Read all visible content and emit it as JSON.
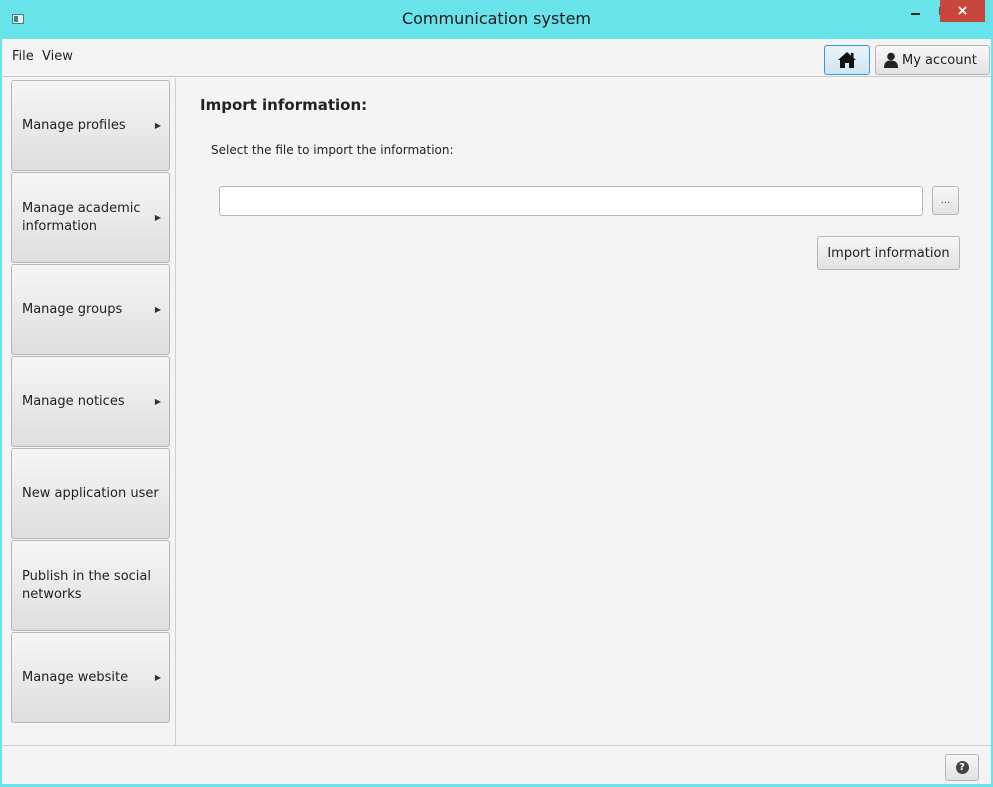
{
  "window": {
    "title": "Communication system",
    "close_glyph": "×",
    "accent_color": "#68e3ea",
    "close_color": "#c7463d"
  },
  "menubar": {
    "items": [
      {
        "label": "File"
      },
      {
        "label": "View"
      }
    ]
  },
  "header": {
    "home_icon": "home-icon",
    "account_label": "My account",
    "account_icon": "user-icon"
  },
  "sidebar": {
    "items": [
      {
        "label": "Manage profiles",
        "arrow": "▶"
      },
      {
        "label": "Manage academic information",
        "arrow": "▶"
      },
      {
        "label": "Manage groups",
        "arrow": "▶"
      },
      {
        "label": "Manage notices",
        "arrow": "▶"
      },
      {
        "label": "New application user",
        "arrow": ""
      },
      {
        "label": "Publish in the social networks",
        "arrow": ""
      },
      {
        "label": "Manage website",
        "arrow": "▶"
      }
    ]
  },
  "main": {
    "title": "Import information:",
    "instruction": "Select the file to import the information:",
    "file_input": {
      "value": "",
      "placeholder": ""
    },
    "browse_label": "...",
    "import_label": "Import information"
  },
  "statusbar": {
    "help_glyph": "?",
    "help_icon": "help-icon"
  }
}
